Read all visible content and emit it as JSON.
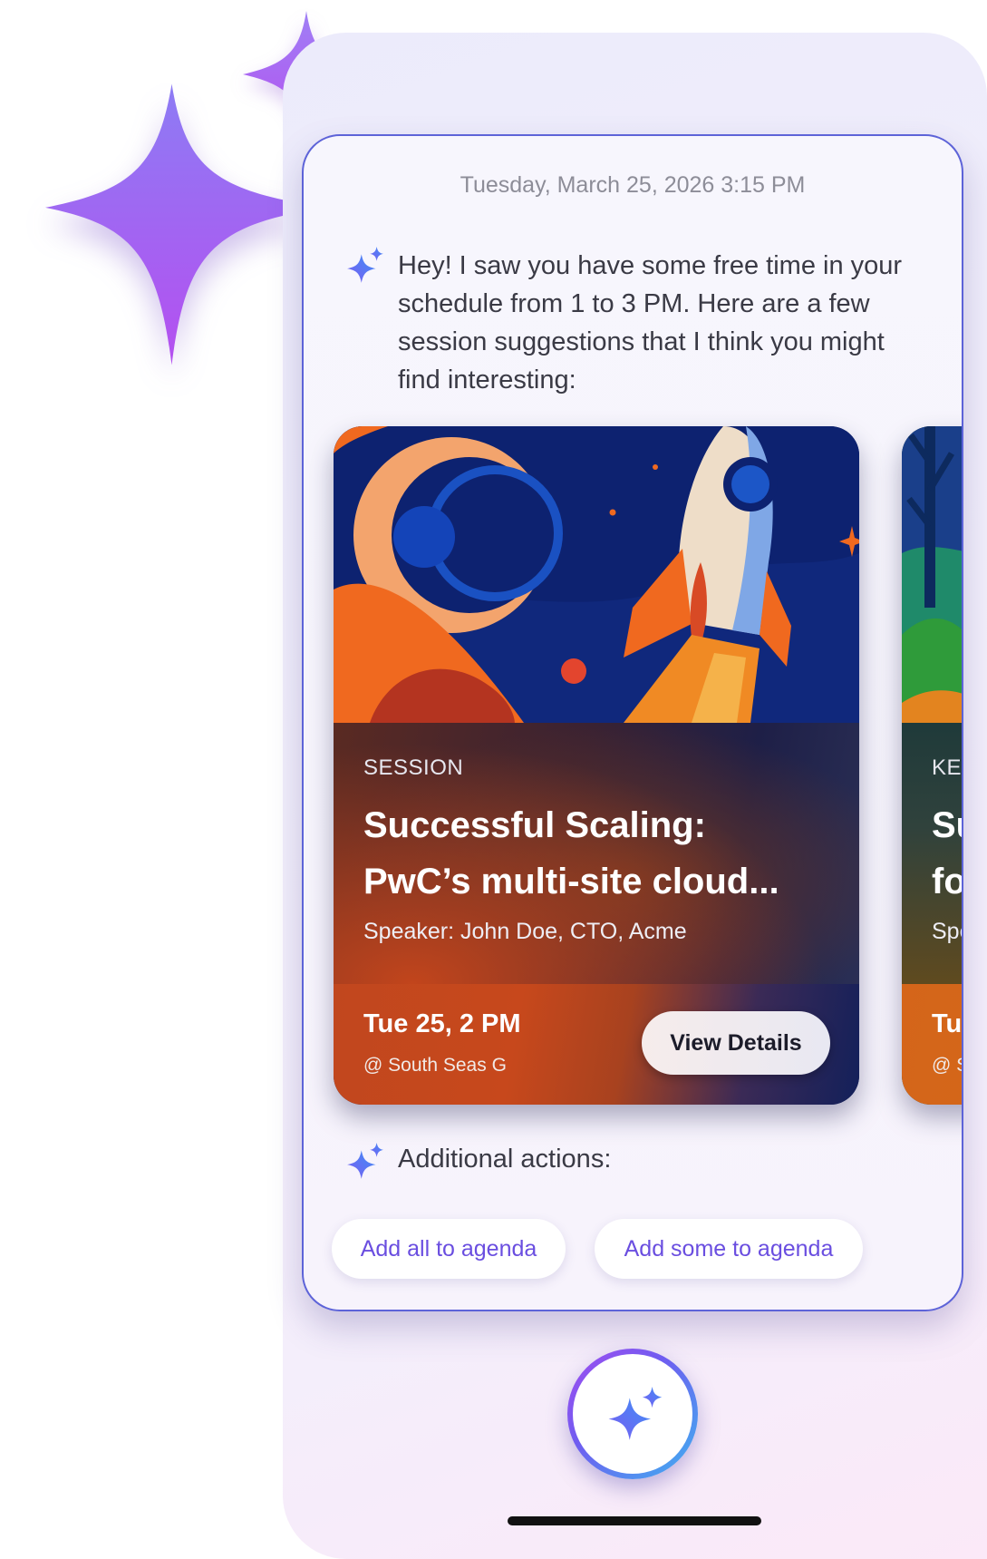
{
  "chat": {
    "timestamp": "Tuesday, March 25, 2026 3:15 PM",
    "message": "Hey! I saw you have some free time in your schedule from 1 to 3 PM. Here are a few session suggestions that I think you might find interesting:",
    "actions_label": "Additional actions:"
  },
  "cards": [
    {
      "kind": "SESSION",
      "title_line1": "Successful Scaling:",
      "title_line2": "PwC’s multi-site cloud...",
      "speaker": "Speaker: John Doe, CTO, Acme",
      "date": "Tue 25, 2 PM",
      "room": "@ South Seas G",
      "button": "View Details"
    },
    {
      "kind": "KEY",
      "title_line1": "Su",
      "title_line2": "fo",
      "speaker": "Spe",
      "date": "Tue",
      "room": "@ S"
    }
  ],
  "actions": {
    "add_all": "Add all to agenda",
    "add_some": "Add some to agenda"
  },
  "icons": {
    "ai": "sparkle-icon",
    "fab": "sparkle-icon",
    "decor": "large-sparkle-icon"
  },
  "colors": {
    "accent": "#6a4ee0",
    "card_border": "#5d63d8",
    "sparkle_start": "#5b8cf5",
    "sparkle_end": "#b347ef"
  }
}
